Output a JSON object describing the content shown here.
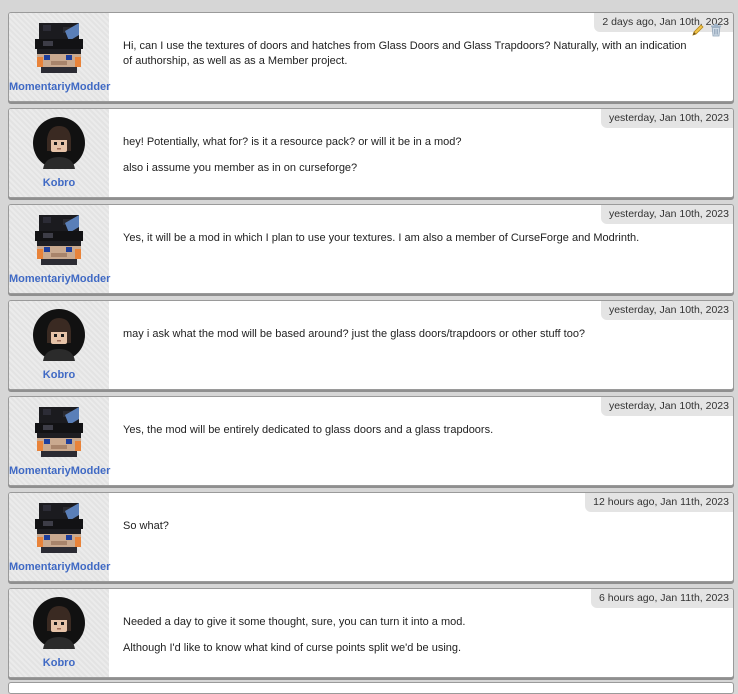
{
  "messages": [
    {
      "author": "MomentariyModder",
      "avatar": "blocky-skin-icon",
      "time": "2 days ago, Jan 10th, 2023",
      "lines": [
        "Hi, can I use the textures of doors and hatches from Glass Doors and Glass Trapdoors? Naturally, with an indication of authorship, as well as as a Member project."
      ],
      "actions": [
        "edit-icon",
        "trash-icon"
      ]
    },
    {
      "author": "Kobro",
      "avatar": "dark-hair-avatar-icon",
      "time": "yesterday, Jan 10th, 2023",
      "lines": [
        "hey! Potentially, what for? is it a resource pack? or will it be in a mod?",
        "also i assume you member as in on curseforge?"
      ]
    },
    {
      "author": "MomentariyModder",
      "avatar": "blocky-skin-icon",
      "time": "yesterday, Jan 10th, 2023",
      "lines": [
        "Yes, it will be a mod in which I plan to use your textures. I am also a member of CurseForge and Modrinth."
      ]
    },
    {
      "author": "Kobro",
      "avatar": "dark-hair-avatar-icon",
      "time": "yesterday, Jan 10th, 2023",
      "lines": [
        "may i ask what the mod will be based around? just the glass doors/trapdoors or other stuff too?"
      ]
    },
    {
      "author": "MomentariyModder",
      "avatar": "blocky-skin-icon",
      "time": "yesterday, Jan 10th, 2023",
      "lines": [
        "Yes, the mod will be entirely dedicated to glass doors and a glass trapdoors."
      ]
    },
    {
      "author": "MomentariyModder",
      "avatar": "blocky-skin-icon",
      "time": "12 hours ago, Jan 11th, 2023",
      "lines": [
        "So what?"
      ]
    },
    {
      "author": "Kobro",
      "avatar": "dark-hair-avatar-icon",
      "time": "6 hours ago, Jan 11th, 2023",
      "lines": [
        "Needed a day to give it some thought, sure, you can turn it into a mod.",
        "Although I'd like to know what kind of curse points split we'd be using."
      ]
    }
  ],
  "colors": {
    "author_link": "#3f69c4",
    "card_bg": "#ffffff",
    "page_bg": "#d6d6d6"
  }
}
